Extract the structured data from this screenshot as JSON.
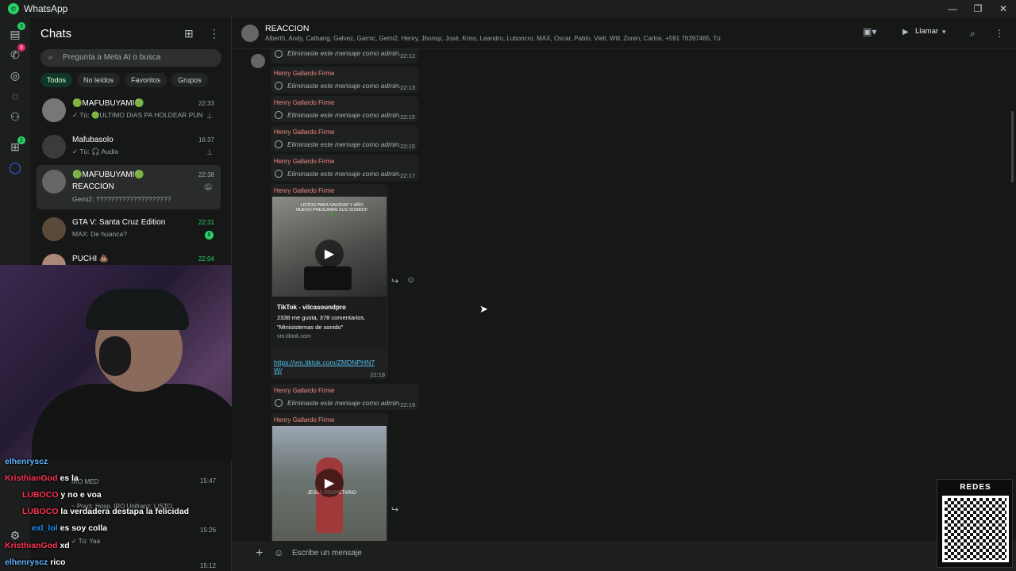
{
  "app": {
    "title": "WhatsApp"
  },
  "rail": {
    "chats_badge": "3",
    "calls_badge": "9",
    "communities_badge": "2"
  },
  "sidebar": {
    "title": "Chats",
    "search_placeholder": "Pregunta a Meta AI o busca",
    "filters": [
      "Todos",
      "No leídos",
      "Favoritos",
      "Grupos"
    ],
    "chats": [
      {
        "name": "🟢MAFUBUYAMI🟢",
        "preview": "✓ Tú: 🟢ULTIMO DIAS PA HOLDEAR PUN...",
        "time": "22:33",
        "icon": "pin-icon"
      },
      {
        "name": "Mafubasolo",
        "preview": "✓ Tú: 🎧 Audio",
        "time": "16:37",
        "icon": "pin-icon"
      },
      {
        "name": "🟢MAFUBUYAMI🟢",
        "subname": "REACCION",
        "preview": "Gemi2: ????????????????????",
        "time": "22:38",
        "icon": "muted-bell-icon"
      },
      {
        "name": "GTA V: Santa Cruz Edition",
        "preview": "MAX: De huanca?",
        "time": "22:31",
        "unread": "8"
      },
      {
        "name": "PUCHI 💩",
        "preview": "",
        "time": "22:04"
      }
    ]
  },
  "chat_stream": [
    {
      "user": "elhenryscz",
      "text": ""
    },
    {
      "user": "KristhianGod",
      "text": "es la"
    },
    {
      "user": "LUBOCO",
      "text": "y no e voa"
    },
    {
      "user": "LUBOCO",
      "text": "la verdadera destapa la felicidad"
    },
    {
      "user": "exl_lol",
      "text": "es soy colla"
    },
    {
      "user": "KristhianGod",
      "text": "xd"
    },
    {
      "user": "elhenryscz",
      "text": "rico"
    }
  ],
  "ghost_sidebar": {
    "t1": "15:47",
    "l1": "IRO MED",
    "l2": "INTERNADO I-26🩺👌",
    "l3": "~ Pract. Hosp. IRO Unifranz: LISTO",
    "t2": "15:26",
    "l4": "cuentas 😂",
    "l5": "✓ Tú: Yaa",
    "t3": "15:12",
    "l6": "Garnic"
  },
  "header": {
    "group_name": "REACCION",
    "members": "Alberth, Andy, Catbang, Galvez, Garnic, Gemi2, Henry, Jhonsp, José, Kriss, Leandro, Luboncro, MAX, Oscar, Pablo, Vielt, Will, Zoren,     Carlos, +591 76397465, Tú",
    "call_label": "Llamar"
  },
  "messages": {
    "sender": "Henry Gallardo Firme",
    "deleted_text": "Eliminaste este mensaje como admin.",
    "deleted_times": [
      "22:12",
      "22:13",
      "22:15",
      "22:15",
      "22:17"
    ],
    "video": {
      "overlay": "LISTOS PARA NAVIDAD Y AÑO NUEVO PRESUMAN SUS SONIDO! 🎄",
      "title": "TikTok - vilcasoundpro",
      "stats": "2338 me gusta, 378 comentarios.",
      "quote": "\"Minisistemas de sonido\"",
      "domain": "vm.tiktok.com",
      "link": "https://vm.tiktok.com/ZMDNPHN7W/",
      "time": "22:18"
    },
    "deleted_after": "22:19",
    "video2_overlay": "JESÚS PROPIETARIO"
  },
  "composer": {
    "placeholder": "Escribe un mensaje"
  },
  "overlay": {
    "qr_label": "REDES"
  },
  "colors": {
    "accent": "#25d366",
    "sender": "#f0897d",
    "link": "#53bdeb"
  }
}
